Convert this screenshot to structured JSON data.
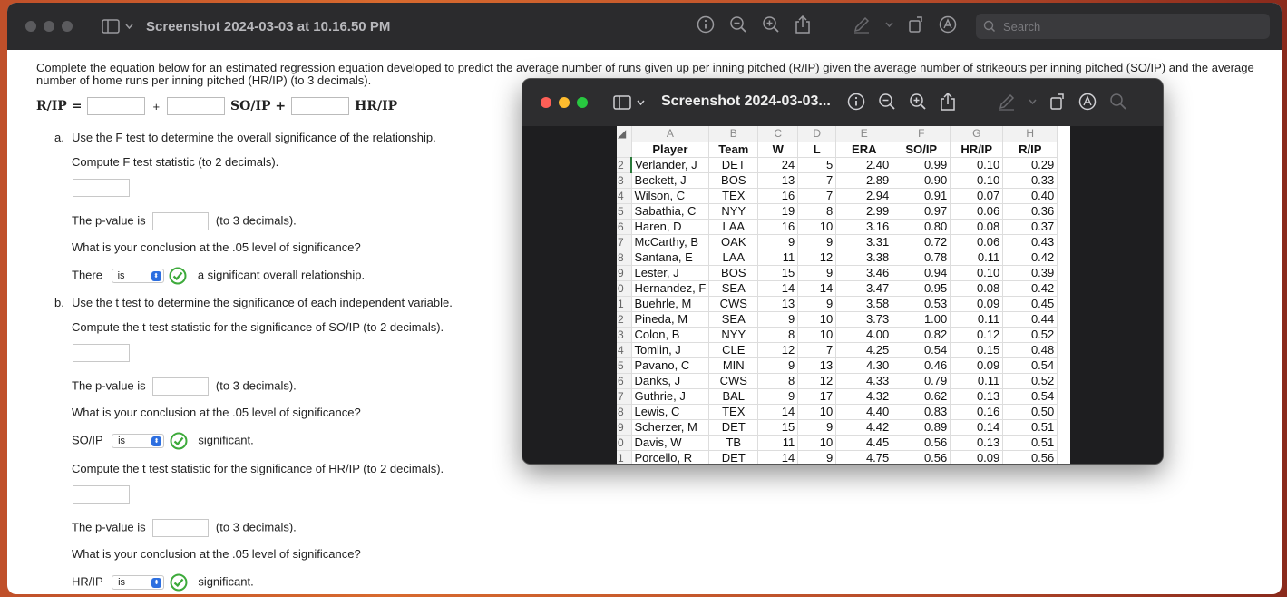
{
  "window": {
    "title": "Screenshot 2024-03-03 at 10.16.50 PM",
    "search_placeholder": "Search"
  },
  "question": {
    "intro": "Complete the equation below for an estimated regression equation developed to predict the average number of runs given up per inning pitched (R/IP) given the average number of strikeouts per inning pitched (SO/IP) and the average number of home runs per inning pitched (HR/IP) (to 3 decimals).",
    "eq_lhs": "R/IP =",
    "eq_plus1": "+",
    "eq_term1": "SO/IP +",
    "eq_term2": "HR/IP",
    "a_label": "a.",
    "a_text": "Use the F test to determine the overall significance of the relationship.",
    "a_compute": "Compute F test statistic (to 2 decimals).",
    "pvalue_prefix": "The p-value is",
    "pvalue_suffix": "(to 3 decimals).",
    "conclusion_q": "What is your conclusion at the .05 level of significance?",
    "there": "There",
    "select_is": "is",
    "overall_rel": "a significant overall relationship.",
    "b_label": "b.",
    "b_text": "Use the t test to determine the significance of each independent variable.",
    "b_compute_so": "Compute the t test statistic for the significance of SO/IP (to 2 decimals).",
    "so_ip": "SO/IP",
    "significant": "significant.",
    "b_compute_hr": "Compute the t test statistic for the significance of HR/IP (to 2 decimals).",
    "hr_ip": "HR/IP"
  },
  "preview": {
    "title": "Screenshot 2024-03-03...",
    "columns": [
      "A",
      "B",
      "C",
      "D",
      "E",
      "F",
      "G",
      "H"
    ],
    "headers": [
      "Player",
      "Team",
      "W",
      "L",
      "ERA",
      "SO/IP",
      "HR/IP",
      "R/IP"
    ],
    "row_numbers": [
      "2",
      "3",
      "4",
      "5",
      "6",
      "7",
      "8",
      "9",
      "0",
      "1",
      "2",
      "3",
      "4",
      "5",
      "6",
      "7",
      "8",
      "9",
      "0",
      "1"
    ],
    "rows": [
      [
        "Verlander, J",
        "DET",
        "24",
        "5",
        "2.40",
        "0.99",
        "0.10",
        "0.29"
      ],
      [
        "Beckett, J",
        "BOS",
        "13",
        "7",
        "2.89",
        "0.90",
        "0.10",
        "0.33"
      ],
      [
        "Wilson, C",
        "TEX",
        "16",
        "7",
        "2.94",
        "0.91",
        "0.07",
        "0.40"
      ],
      [
        "Sabathia, C",
        "NYY",
        "19",
        "8",
        "2.99",
        "0.97",
        "0.06",
        "0.36"
      ],
      [
        "Haren, D",
        "LAA",
        "16",
        "10",
        "3.16",
        "0.80",
        "0.08",
        "0.37"
      ],
      [
        "McCarthy, B",
        "OAK",
        "9",
        "9",
        "3.31",
        "0.72",
        "0.06",
        "0.43"
      ],
      [
        "Santana, E",
        "LAA",
        "11",
        "12",
        "3.38",
        "0.78",
        "0.11",
        "0.42"
      ],
      [
        "Lester, J",
        "BOS",
        "15",
        "9",
        "3.46",
        "0.94",
        "0.10",
        "0.39"
      ],
      [
        "Hernandez, F",
        "SEA",
        "14",
        "14",
        "3.47",
        "0.95",
        "0.08",
        "0.42"
      ],
      [
        "Buehrle, M",
        "CWS",
        "13",
        "9",
        "3.58",
        "0.53",
        "0.09",
        "0.45"
      ],
      [
        "Pineda, M",
        "SEA",
        "9",
        "10",
        "3.73",
        "1.00",
        "0.11",
        "0.44"
      ],
      [
        "Colon, B",
        "NYY",
        "8",
        "10",
        "4.00",
        "0.82",
        "0.12",
        "0.52"
      ],
      [
        "Tomlin, J",
        "CLE",
        "12",
        "7",
        "4.25",
        "0.54",
        "0.15",
        "0.48"
      ],
      [
        "Pavano, C",
        "MIN",
        "9",
        "13",
        "4.30",
        "0.46",
        "0.09",
        "0.54"
      ],
      [
        "Danks, J",
        "CWS",
        "8",
        "12",
        "4.33",
        "0.79",
        "0.11",
        "0.52"
      ],
      [
        "Guthrie, J",
        "BAL",
        "9",
        "17",
        "4.32",
        "0.62",
        "0.13",
        "0.54"
      ],
      [
        "Lewis, C",
        "TEX",
        "14",
        "10",
        "4.40",
        "0.83",
        "0.16",
        "0.50"
      ],
      [
        "Scherzer, M",
        "DET",
        "15",
        "9",
        "4.42",
        "0.89",
        "0.14",
        "0.51"
      ],
      [
        "Davis, W",
        "TB",
        "11",
        "10",
        "4.45",
        "0.56",
        "0.13",
        "0.51"
      ],
      [
        "Porcello, R",
        "DET",
        "14",
        "9",
        "4.75",
        "0.56",
        "0.09",
        "0.56"
      ]
    ]
  },
  "colors": {
    "close": "#fe5f57",
    "minimize": "#febc2e",
    "zoom": "#28c840",
    "check": "#3daa3b",
    "select_accent": "#2d6fe0"
  }
}
